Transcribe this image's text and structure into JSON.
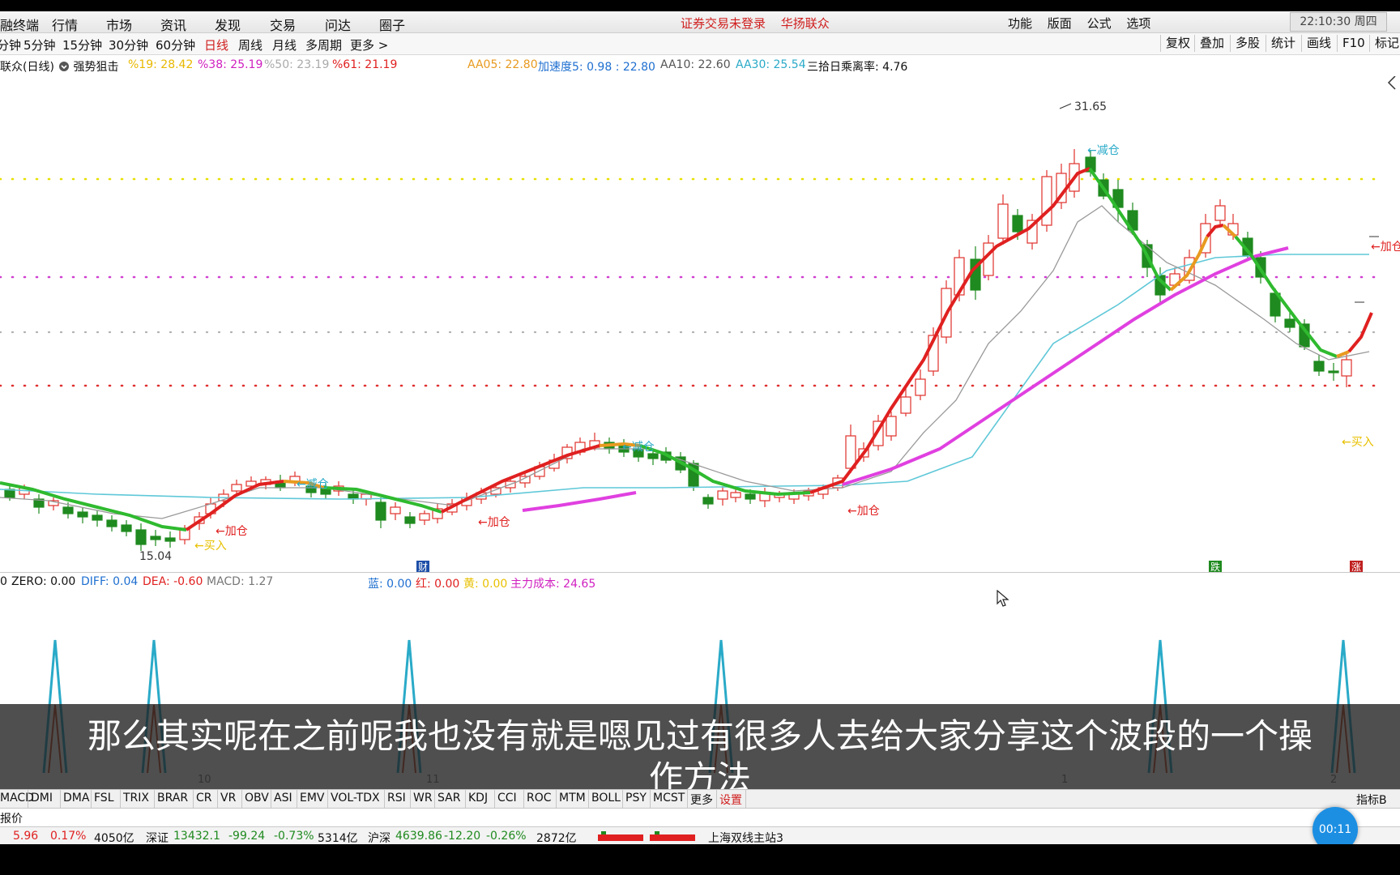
{
  "menu": {
    "items": [
      "融终端",
      "行情",
      "市场",
      "资讯",
      "发现",
      "交易",
      "问达",
      "圈子"
    ],
    "notice": [
      "证券交易未登录",
      "华扬联众"
    ],
    "right_items": [
      "功能",
      "版面",
      "公式",
      "选项"
    ],
    "clock": "22:10:30 周四"
  },
  "periods": {
    "items": [
      "分钟",
      "5分钟",
      "15分钟",
      "30分钟",
      "60分钟",
      "日线",
      "周线",
      "月线",
      "多周期",
      "更多 >"
    ],
    "active": "日线",
    "tools": [
      "复权",
      "叠加",
      "多股",
      "统计",
      "画线",
      "F10",
      "标记"
    ]
  },
  "info": {
    "stock": "联众(日线)",
    "indicator": "强势狙击",
    "pct19": "%19: 28.42",
    "pct38": "%38: 25.19",
    "pct50": "%50: 23.19",
    "pct61": "%61: 21.19",
    "aa05": "AA05: 22.80",
    "accel": "加速度5: 0.98 : 22.80",
    "aa10": "AA10: 22.60",
    "aa30": "AA30: 25.54",
    "deviation": "三拾日乘离率: 4.76"
  },
  "chart_labels": {
    "high": "31.65",
    "low": "15.04",
    "reduce": "←减仓",
    "add": "←加仓",
    "buy": "←买入",
    "cai": "财",
    "die": "跌",
    "zhang": "涨"
  },
  "colors": {
    "up": "#e0302a",
    "down": "#1f8a1f",
    "ma_orange": "#e89a20",
    "ma_pink": "#e040e0",
    "ma_cyan": "#5fc8d8",
    "ma_gray": "#999999",
    "level_yellow": "#e8e000",
    "level_magenta": "#d040d0",
    "level_red": "#e03030"
  },
  "macd_info": {
    "zero": "ZERO: 0.00",
    "diff": "DIFF: 0.04",
    "dea": "DEA: -0.60",
    "macd": "MACD: 1.27",
    "blue": "蓝: 0.00",
    "red": "红: 0.00",
    "yellow": "黄: 0.00",
    "cost": "主力成本: 24.65"
  },
  "subtitle": {
    "line1": "那么其实呢在之前呢我也没有就是嗯见过有很多人去给大家分享这个波段的一个操",
    "line2": "作方法"
  },
  "dates": [
    "10",
    "11",
    "1",
    "2"
  ],
  "indicator_tabs": [
    "MACD",
    "DMI",
    "DMA",
    "FSL",
    "TRIX",
    "BRAR",
    "CR",
    "VR",
    "OBV",
    "ASI",
    "EMV",
    "VOL-TDX",
    "RSI",
    "WR",
    "SAR",
    "KDJ",
    "CCI",
    "ROC",
    "MTM",
    "BOLL",
    "PSY",
    "MCST",
    "更多",
    "设置"
  ],
  "indicator_right": "指标B",
  "price_label": "报价",
  "status": {
    "s1": "5.96",
    "s2": "0.17%",
    "s3": "4050亿",
    "sz_name": "深证",
    "sz_val": "13432.1",
    "sz_chg": "-99.24",
    "sz_pct": "-0.73%",
    "sz_amt": "5314亿",
    "sh_name": "沪深",
    "sh_val": "4639.86",
    "sh_chg": "-12.20",
    "sh_pct": "-0.26%",
    "sh_amt": "2872亿",
    "station": "上海双线主站3"
  },
  "timer": "00:11"
}
